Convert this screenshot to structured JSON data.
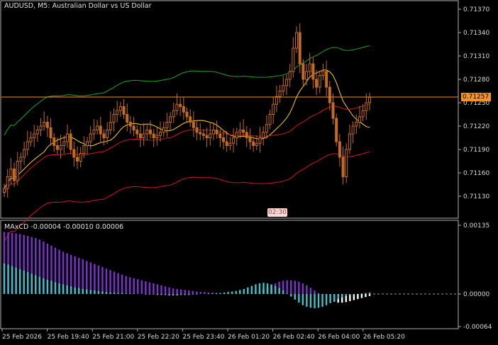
{
  "window": {
    "title": "AUDUSD, M5:  Australian Dollar vs US Dollar",
    "indicator_label": "MAxCD -0.00004 -0.00010 0.00006"
  },
  "current_price": "0.71257",
  "cursor_time": "02:30",
  "colors": {
    "background": "#000000",
    "frame": "#b0b0b0",
    "candle": "#c36b1e",
    "ma_yellow": "#ffd21e",
    "ma_red": "#d8131d",
    "ma_green": "#1ea61e",
    "macd_purple": "#7b33cc",
    "macd_cyan": "#3fc1c9",
    "macd_white": "#ffffff",
    "price_line": "#f7931e"
  },
  "chart_data": [
    {
      "type": "candlestick",
      "price_axis": {
        "ticks": [
          "0.71370",
          "0.71340",
          "0.71310",
          "0.71280",
          "0.71250",
          "0.71220",
          "0.71190",
          "0.71160",
          "0.71130"
        ],
        "ylim": [
          0.71106,
          0.71382
        ]
      },
      "time_axis": {
        "ticks": [
          "25 Feb 2026",
          "25 Feb 19:40",
          "25 Feb 21:00",
          "25 Feb 22:20",
          "25 Feb 23:40",
          "26 Feb 01:20",
          "26 Feb 02:40",
          "26 Feb 04:00",
          "26 Feb 05:20"
        ]
      },
      "series": [
        {
          "kind": "ohlc",
          "values_close": [
            0.7114,
            0.71155,
            0.71165,
            0.7115,
            0.71175,
            0.7118,
            0.7119,
            0.712,
            0.71205,
            0.7121,
            0.71215,
            0.7122,
            0.71225,
            0.71218,
            0.71205,
            0.71195,
            0.7119,
            0.71195,
            0.712,
            0.7121,
            0.7119,
            0.7118,
            0.71175,
            0.71185,
            0.71195,
            0.712,
            0.7121,
            0.71215,
            0.7122,
            0.7121,
            0.71205,
            0.71215,
            0.71225,
            0.71235,
            0.7124,
            0.71245,
            0.71235,
            0.71225,
            0.7122,
            0.71215,
            0.7121,
            0.71205,
            0.7121,
            0.71215,
            0.7121,
            0.71205,
            0.71208,
            0.71212,
            0.71218,
            0.71225,
            0.71232,
            0.7124,
            0.71248,
            0.71245,
            0.71238,
            0.71232,
            0.71225,
            0.71218,
            0.71212,
            0.7121,
            0.71208,
            0.71205,
            0.7121,
            0.71215,
            0.7121,
            0.71205,
            0.712,
            0.71195,
            0.71198,
            0.71205,
            0.71212,
            0.71215,
            0.71212,
            0.71205,
            0.712,
            0.71195,
            0.71198,
            0.71205,
            0.71212,
            0.71222,
            0.71235,
            0.71248,
            0.71258,
            0.71265,
            0.71272,
            0.7128,
            0.7129,
            0.7132,
            0.7134,
            0.713,
            0.7128,
            0.7129,
            0.713,
            0.7128,
            0.7127,
            0.71285,
            0.7129,
            0.7127,
            0.7125,
            0.7123,
            0.712,
            0.7118,
            0.71155,
            0.7119,
            0.7121,
            0.7122,
            0.71225,
            0.71232,
            0.7124,
            0.7125,
            0.71257
          ]
        }
      ]
    },
    {
      "type": "histogram",
      "value_axis": {
        "ticks": [
          "0.00135",
          "0.00000",
          "-0.00064"
        ],
        "ylim": [
          -0.0007,
          0.0014
        ]
      },
      "series": [
        {
          "name": "MAxCD",
          "values": [
            0.00122,
            0.00121,
            0.0012,
            0.00119,
            0.00118,
            0.00116,
            0.00114,
            0.00112,
            0.0011,
            0.00107,
            0.00103,
            0.00099,
            0.00095,
            0.00091,
            0.00087,
            0.00083,
            0.0008,
            0.00077,
            0.00074,
            0.00071,
            0.00068,
            0.00065,
            0.00062,
            0.00059,
            0.00056,
            0.00053,
            0.0005,
            0.00047,
            0.00044,
            0.00041,
            0.00038,
            0.00035,
            0.00033,
            0.00031,
            0.00029,
            0.00027,
            0.00025,
            0.00023,
            0.00021,
            0.00019,
            0.00017,
            0.00015,
            0.00013,
            0.00011,
            0.0001,
            9e-05,
            8e-05,
            7e-05,
            6e-05,
            5e-05,
            4e-05,
            4e-05,
            3e-05,
            3e-05,
            2e-05,
            2e-05,
            1e-05,
            1e-05,
            0.0,
            0.0,
            1e-05,
            1e-05,
            2e-05,
            3e-05,
            4e-05,
            6e-05,
            9e-05,
            0.00013,
            0.00017,
            0.00021,
            0.00024,
            0.00026,
            0.00027,
            0.00027,
            0.00026,
            0.00024,
            0.00021,
            0.00017,
            0.00012,
            7e-05,
            2e-05,
            -3e-05,
            -8e-05,
            -0.00012,
            -0.00015,
            -0.00017,
            -0.00017,
            -0.00016,
            -0.00014,
            -0.00012,
            -0.0001,
            -8e-05,
            -6e-05,
            -4e-05
          ]
        },
        {
          "name": "Signal",
          "values": [
            0.0006,
            0.00058,
            0.00055,
            0.00052,
            0.00049,
            0.00046,
            0.00043,
            0.0004,
            0.00037,
            0.00034,
            0.00031,
            0.00028,
            0.00026,
            0.00023,
            0.00021,
            0.00019,
            0.00017,
            0.00015,
            0.00013,
            0.00012,
            0.0001,
            9e-05,
            8e-05,
            7e-05,
            6e-05,
            5e-05,
            4e-05,
            3e-05,
            3e-05,
            2e-05,
            2e-05,
            1e-05,
            1e-05,
            1e-05,
            0.0,
            0.0,
            -1e-05,
            -1e-05,
            -1e-05,
            -2e-05,
            -2e-05,
            -2e-05,
            -3e-05,
            -3e-05,
            -3e-05,
            -2e-05,
            -2e-05,
            -2e-05,
            -1e-05,
            -1e-05,
            0.0,
            0.0,
            1e-05,
            1e-05,
            2e-05,
            2e-05,
            3e-05,
            4e-05,
            5e-05,
            6e-05,
            8e-05,
            0.0001,
            0.00013,
            0.00016,
            0.00019,
            0.00021,
            0.00022,
            0.00021,
            0.00019,
            0.00016,
            0.00012,
            7e-05,
            1e-05,
            -5e-05,
            -0.00011,
            -0.00017,
            -0.00022,
            -0.00025,
            -0.00027,
            -0.00028,
            -0.00027,
            -0.00025,
            -0.00022,
            -0.00018,
            -0.00014,
            -0.0001,
            -7e-05,
            -4e-05,
            -2e-05,
            -1e-05,
            0.0,
            1e-05,
            2e-05,
            3e-05
          ]
        }
      ]
    }
  ]
}
